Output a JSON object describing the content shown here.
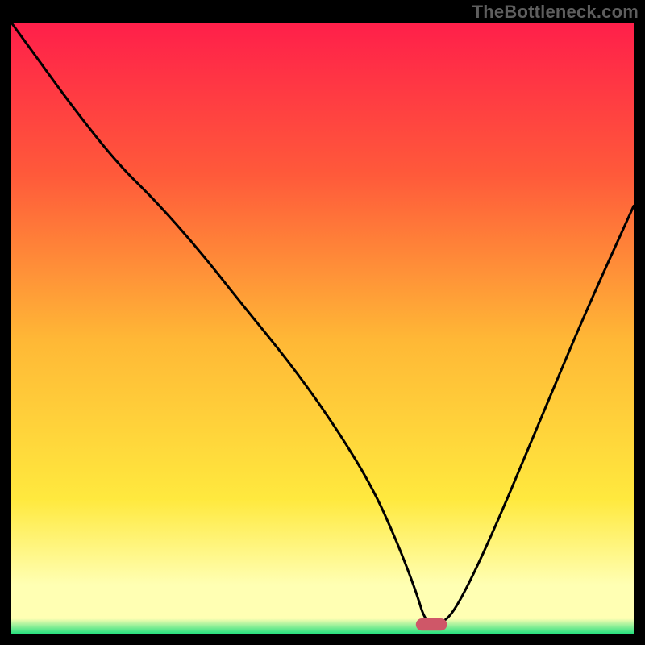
{
  "watermark": "TheBottleneck.com",
  "colors": {
    "frame_bg": "#000000",
    "grad_top": "#ff1f4a",
    "grad_upper_mid": "#ff5a3a",
    "grad_mid": "#ffb836",
    "grad_lower_mid": "#ffe93e",
    "grad_pale_yellow": "#ffffb3",
    "grad_green": "#26e07e",
    "curve_stroke": "#000000",
    "marker_fill": "#cf5768",
    "watermark_color": "#5e5e5e"
  },
  "chart_data": {
    "type": "line",
    "title": "",
    "xlabel": "",
    "ylabel": "",
    "xlim": [
      0,
      100
    ],
    "ylim": [
      0,
      100
    ],
    "grid": false,
    "legend": false,
    "x": [
      0,
      5,
      10,
      17,
      23,
      30,
      37,
      45,
      52,
      58,
      62,
      65,
      66.5,
      68,
      70,
      73,
      78,
      85,
      92,
      100
    ],
    "values": [
      100,
      93,
      86,
      77,
      71,
      63,
      54,
      44,
      34,
      24,
      15,
      7,
      2,
      2,
      2,
      7,
      18,
      35,
      52,
      70
    ],
    "marker": {
      "x": 67.5,
      "y": 1.5,
      "width": 5,
      "height": 2
    },
    "note": "x/y in percent of plot area; y measured from bottom (0=bottom, 100=top)."
  }
}
